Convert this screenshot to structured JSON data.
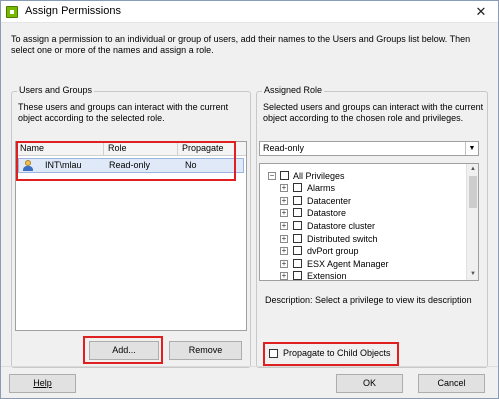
{
  "window": {
    "title": "Assign Permissions"
  },
  "intro_text": "To assign a permission to an individual or group of users, add their names to the Users and Groups list below. Then select one or more of the names and assign a role.",
  "users_groups": {
    "title": "Users and Groups",
    "description": "These users and groups can interact with the current object according to the selected role.",
    "columns": [
      "Name",
      "Role",
      "Propagate"
    ],
    "rows": [
      {
        "name": "INT\\mlau",
        "role": "Read-only",
        "propagate": "No"
      }
    ],
    "add_label": "Add...",
    "remove_label": "Remove"
  },
  "assigned_role": {
    "title": "Assigned Role",
    "description": "Selected users and groups can interact with the current object according to the chosen role and privileges.",
    "selected_role": "Read-only",
    "privileges": [
      "All Privileges",
      "Alarms",
      "Datacenter",
      "Datastore",
      "Datastore cluster",
      "Distributed switch",
      "dvPort group",
      "ESX Agent Manager",
      "Extension"
    ],
    "description_label": "Description:",
    "description_value": "Select a privilege to view its description",
    "propagate_label": "Propagate to Child Objects"
  },
  "footer": {
    "help_label": "Help",
    "ok_label": "OK",
    "cancel_label": "Cancel"
  },
  "colors": {
    "highlight_box": "#e02020",
    "selection": "#dfe9f7"
  }
}
